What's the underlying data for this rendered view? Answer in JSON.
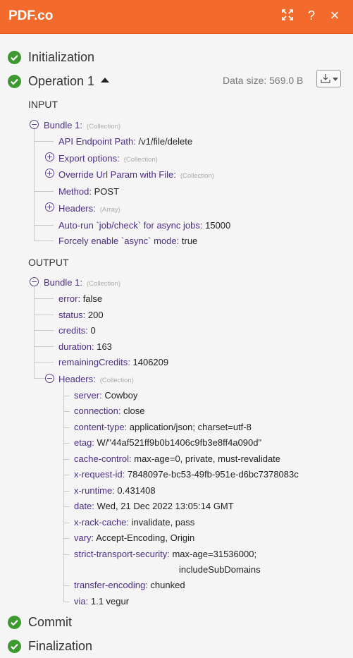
{
  "header": {
    "title": "PDF.co",
    "help_label": "?",
    "close_label": "×"
  },
  "sections": {
    "initialization": "Initialization",
    "operation": "Operation 1",
    "commit": "Commit",
    "finalization": "Finalization"
  },
  "data_size": "Data size: 569.0 B",
  "input": {
    "label": "INPUT",
    "bundle": {
      "key": "Bundle 1:",
      "tag": "(Collection)"
    },
    "rows": [
      {
        "key": "API Endpoint Path:",
        "value": "/v1/file/delete",
        "tag": ""
      },
      {
        "key": "Export options:",
        "value": "",
        "tag": "(Collection)"
      },
      {
        "key": "Override Url Param with File:",
        "value": "",
        "tag": "(Collection)"
      },
      {
        "key": "Method:",
        "value": "POST",
        "tag": ""
      },
      {
        "key": "Headers:",
        "value": "",
        "tag": "(Array)"
      },
      {
        "key": "Auto-run `job/check` for async jobs:",
        "value": "15000",
        "tag": ""
      },
      {
        "key": "Forcely enable `async` mode:",
        "value": "true",
        "tag": ""
      }
    ]
  },
  "output": {
    "label": "OUTPUT",
    "bundle": {
      "key": "Bundle 1:",
      "tag": "(Collection)"
    },
    "rows": [
      {
        "key": "error:",
        "value": "false"
      },
      {
        "key": "status:",
        "value": "200"
      },
      {
        "key": "credits:",
        "value": "0"
      },
      {
        "key": "duration:",
        "value": "163"
      },
      {
        "key": "remainingCredits:",
        "value": "1406209"
      }
    ],
    "headers": {
      "key": "Headers:",
      "tag": "(Collection)",
      "rows": [
        {
          "key": "server:",
          "value": "Cowboy"
        },
        {
          "key": "connection:",
          "value": "close"
        },
        {
          "key": "content-type:",
          "value": "application/json; charset=utf-8"
        },
        {
          "key": "etag:",
          "value": "W/\"44af521ff9b0b1406c9fb3e8ff4a090d\""
        },
        {
          "key": "cache-control:",
          "value": "max-age=0, private, must-revalidate"
        },
        {
          "key": "x-request-id:",
          "value": "7848097e-bc53-49fb-951e-d6bc7378083c"
        },
        {
          "key": "x-runtime:",
          "value": "0.431408"
        },
        {
          "key": "date:",
          "value": "Wed, 21 Dec 2022 13:05:14 GMT"
        },
        {
          "key": "x-rack-cache:",
          "value": "invalidate, pass"
        },
        {
          "key": "vary:",
          "value": "Accept-Encoding, Origin"
        },
        {
          "key": "strict-transport-security:",
          "value": "max-age=31536000;",
          "value2": "includeSubDomains"
        },
        {
          "key": "transfer-encoding:",
          "value": "chunked"
        },
        {
          "key": "via:",
          "value": "1.1 vegur"
        }
      ]
    }
  },
  "colors": {
    "header_bg": "#f26b2d",
    "success": "#3d9a2f",
    "key_text": "#4b2d83"
  }
}
